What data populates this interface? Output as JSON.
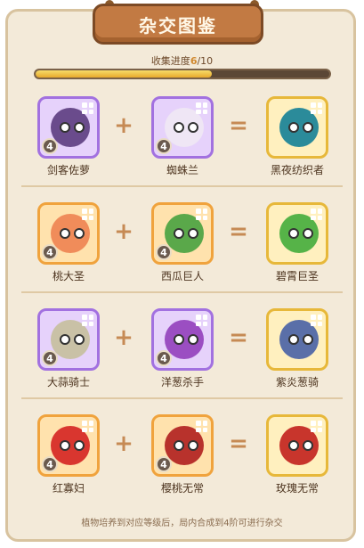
{
  "title": "杂交图鉴",
  "progress": {
    "label": "收集进度",
    "current": "6",
    "total": "/10",
    "fraction": 0.6
  },
  "recipes": [
    {
      "left": {
        "name": "剑客佐萝",
        "level": "4",
        "theme": "purple",
        "color": "#6a4b8c"
      },
      "right": {
        "name": "蜘蛛兰",
        "level": "4",
        "theme": "purple",
        "color": "#efe6f5"
      },
      "result": {
        "name": "黑夜纺织者",
        "level": "",
        "theme": "gold",
        "color": "#2b8b9a"
      }
    },
    {
      "left": {
        "name": "桃大圣",
        "level": "4",
        "theme": "orange",
        "color": "#f08c5a"
      },
      "right": {
        "name": "西瓜巨人",
        "level": "4",
        "theme": "orange",
        "color": "#5aa84a"
      },
      "result": {
        "name": "碧霄巨圣",
        "level": "",
        "theme": "gold",
        "color": "#56b348"
      }
    },
    {
      "left": {
        "name": "大蒜骑士",
        "level": "4",
        "theme": "purple",
        "color": "#c9c1a6"
      },
      "right": {
        "name": "洋葱杀手",
        "level": "4",
        "theme": "purple",
        "color": "#9b4ec2"
      },
      "result": {
        "name": "紫炎葱骑",
        "level": "",
        "theme": "gold",
        "color": "#5a6fa8"
      }
    },
    {
      "left": {
        "name": "红寡妇",
        "level": "4",
        "theme": "orange",
        "color": "#d9362f"
      },
      "right": {
        "name": "樱桃无常",
        "level": "4",
        "theme": "orange",
        "color": "#b8322c"
      },
      "result": {
        "name": "玫瑰无常",
        "level": "",
        "theme": "gold",
        "color": "#c8352c"
      }
    }
  ],
  "operators": {
    "plus": "+",
    "equals": "="
  },
  "footer": "植物培养到对应等级后，局内合成到4阶可进行杂交",
  "colors": {
    "banner": "#c27a43",
    "panel": "#f3ead9",
    "progress_fill": "#e8a92c"
  }
}
